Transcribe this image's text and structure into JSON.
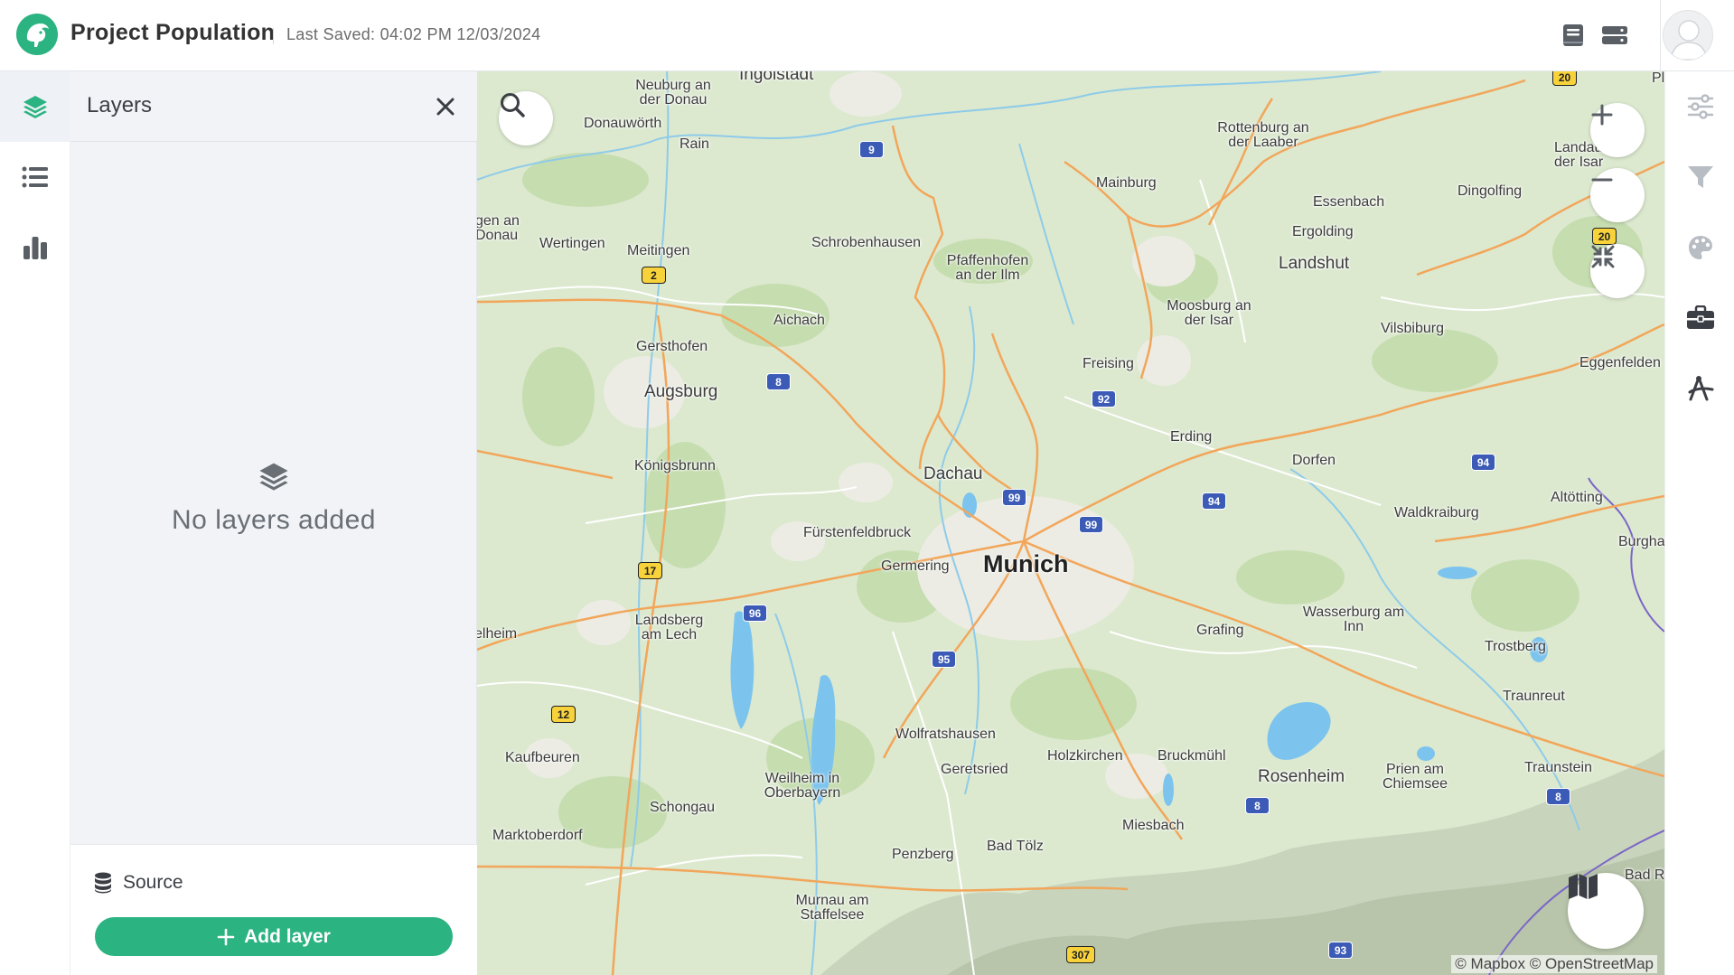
{
  "header": {
    "app_title": "Project Population",
    "last_saved": "Last Saved: 04:02 PM 12/03/2024"
  },
  "left_rail": {
    "items": [
      {
        "name": "layers",
        "icon": "layers-icon",
        "active": true
      },
      {
        "name": "legend",
        "icon": "list-icon",
        "active": false
      },
      {
        "name": "charts",
        "icon": "bar-chart-icon",
        "active": false
      }
    ]
  },
  "layers_panel": {
    "title": "Layers",
    "empty_text": "No layers added",
    "source_label": "Source",
    "add_layer_label": "Add layer"
  },
  "map": {
    "attribution": "© Mapbox © OpenStreetMap",
    "places": [
      {
        "name": "Munich",
        "cls": "city"
      },
      {
        "name": "Ingolstadt",
        "cls": "mid"
      },
      {
        "name": "Augsburg",
        "cls": "mid"
      },
      {
        "name": "Landshut",
        "cls": "mid"
      },
      {
        "name": "Dachau",
        "cls": "mid"
      },
      {
        "name": "Rosenheim",
        "cls": "mid"
      },
      {
        "name": "Neuburg an der Donau",
        "cls": "small"
      },
      {
        "name": "Donauwörth",
        "cls": "small"
      },
      {
        "name": "Rain",
        "cls": "small"
      },
      {
        "name": "Rottenburg an der Laaber",
        "cls": "small"
      },
      {
        "name": "Landau der Isar",
        "cls": "small"
      },
      {
        "name": "Mainburg",
        "cls": "small"
      },
      {
        "name": "Essenbach",
        "cls": "small"
      },
      {
        "name": "Dingolfing",
        "cls": "small"
      },
      {
        "name": "Ergolding",
        "cls": "small"
      },
      {
        "name": "Schrobenhausen",
        "cls": "small"
      },
      {
        "name": "Pfaffenhofen an der Ilm",
        "cls": "small"
      },
      {
        "name": "Wertingen",
        "cls": "small"
      },
      {
        "name": "Meitingen",
        "cls": "small"
      },
      {
        "name": "gen an Donau",
        "cls": "small"
      },
      {
        "name": "Aichach",
        "cls": "small"
      },
      {
        "name": "Moosburg an der Isar",
        "cls": "small"
      },
      {
        "name": "Vilsbiburg",
        "cls": "small"
      },
      {
        "name": "Gersthofen",
        "cls": "small"
      },
      {
        "name": "Freising",
        "cls": "small"
      },
      {
        "name": "Eggenfelden",
        "cls": "small"
      },
      {
        "name": "Erding",
        "cls": "small"
      },
      {
        "name": "Königsbrunn",
        "cls": "small"
      },
      {
        "name": "Dorfen",
        "cls": "small"
      },
      {
        "name": "Altötting",
        "cls": "small"
      },
      {
        "name": "Waldkraiburg",
        "cls": "small"
      },
      {
        "name": "Fürstenfeldbruck",
        "cls": "small"
      },
      {
        "name": "Burgha",
        "cls": "small"
      },
      {
        "name": "Germering",
        "cls": "small"
      },
      {
        "name": "Landsberg am Lech",
        "cls": "small"
      },
      {
        "name": "Wasserburg am Inn",
        "cls": "small"
      },
      {
        "name": "elheim",
        "cls": "small"
      },
      {
        "name": "Grafing",
        "cls": "small"
      },
      {
        "name": "Trostberg",
        "cls": "small"
      },
      {
        "name": "Traunreut",
        "cls": "small"
      },
      {
        "name": "Wolfratshausen",
        "cls": "small"
      },
      {
        "name": "Kaufbeuren",
        "cls": "small"
      },
      {
        "name": "Holzkirchen",
        "cls": "small"
      },
      {
        "name": "Bruckmühl",
        "cls": "small"
      },
      {
        "name": "Geretsried",
        "cls": "small"
      },
      {
        "name": "Prien am Chiemsee",
        "cls": "small"
      },
      {
        "name": "Traunstein",
        "cls": "small"
      },
      {
        "name": "Weilheim in Oberbayern",
        "cls": "small"
      },
      {
        "name": "Schongau",
        "cls": "small"
      },
      {
        "name": "Miesbach",
        "cls": "small"
      },
      {
        "name": "Marktoberdorf",
        "cls": "small"
      },
      {
        "name": "Penzberg",
        "cls": "small"
      },
      {
        "name": "Bad Tölz",
        "cls": "small"
      },
      {
        "name": "Bad R",
        "cls": "small"
      },
      {
        "name": "Murnau am Staffelsee",
        "cls": "small"
      },
      {
        "name": "Pl",
        "cls": "small"
      }
    ],
    "shields": [
      {
        "label": "9",
        "type": "blue"
      },
      {
        "label": "2",
        "type": "yellow"
      },
      {
        "label": "8",
        "type": "blue"
      },
      {
        "label": "92",
        "type": "blue"
      },
      {
        "label": "99",
        "type": "blue"
      },
      {
        "label": "99",
        "type": "blue"
      },
      {
        "label": "94",
        "type": "blue"
      },
      {
        "label": "94",
        "type": "blue"
      },
      {
        "label": "17",
        "type": "yellow"
      },
      {
        "label": "96",
        "type": "blue"
      },
      {
        "label": "95",
        "type": "blue"
      },
      {
        "label": "12",
        "type": "yellow"
      },
      {
        "label": "8",
        "type": "blue"
      },
      {
        "label": "8",
        "type": "blue"
      },
      {
        "label": "307",
        "type": "yellow"
      },
      {
        "label": "93",
        "type": "blue"
      },
      {
        "label": "20",
        "type": "yellow"
      },
      {
        "label": "20",
        "type": "yellow"
      }
    ]
  },
  "map_controls": {
    "search": "search-icon",
    "zoom_in": "plus-icon",
    "zoom_out": "minus-icon",
    "fit": "collapse-icon",
    "basemap": "map-icon"
  },
  "right_rail": {
    "items": [
      {
        "name": "properties",
        "icon": "sliders-icon"
      },
      {
        "name": "filter",
        "icon": "filter-icon"
      },
      {
        "name": "style",
        "icon": "palette-icon"
      },
      {
        "name": "toolbox",
        "icon": "toolbox-icon"
      },
      {
        "name": "draw",
        "icon": "draw-icon"
      }
    ]
  },
  "colors": {
    "brand": "#2bb381",
    "map_land": "#dce9cf",
    "road_major": "#f2a65a",
    "water": "#7cc4ee",
    "motorway_shield": "#3b5bb6",
    "state_road_shield": "#f7d23a"
  }
}
